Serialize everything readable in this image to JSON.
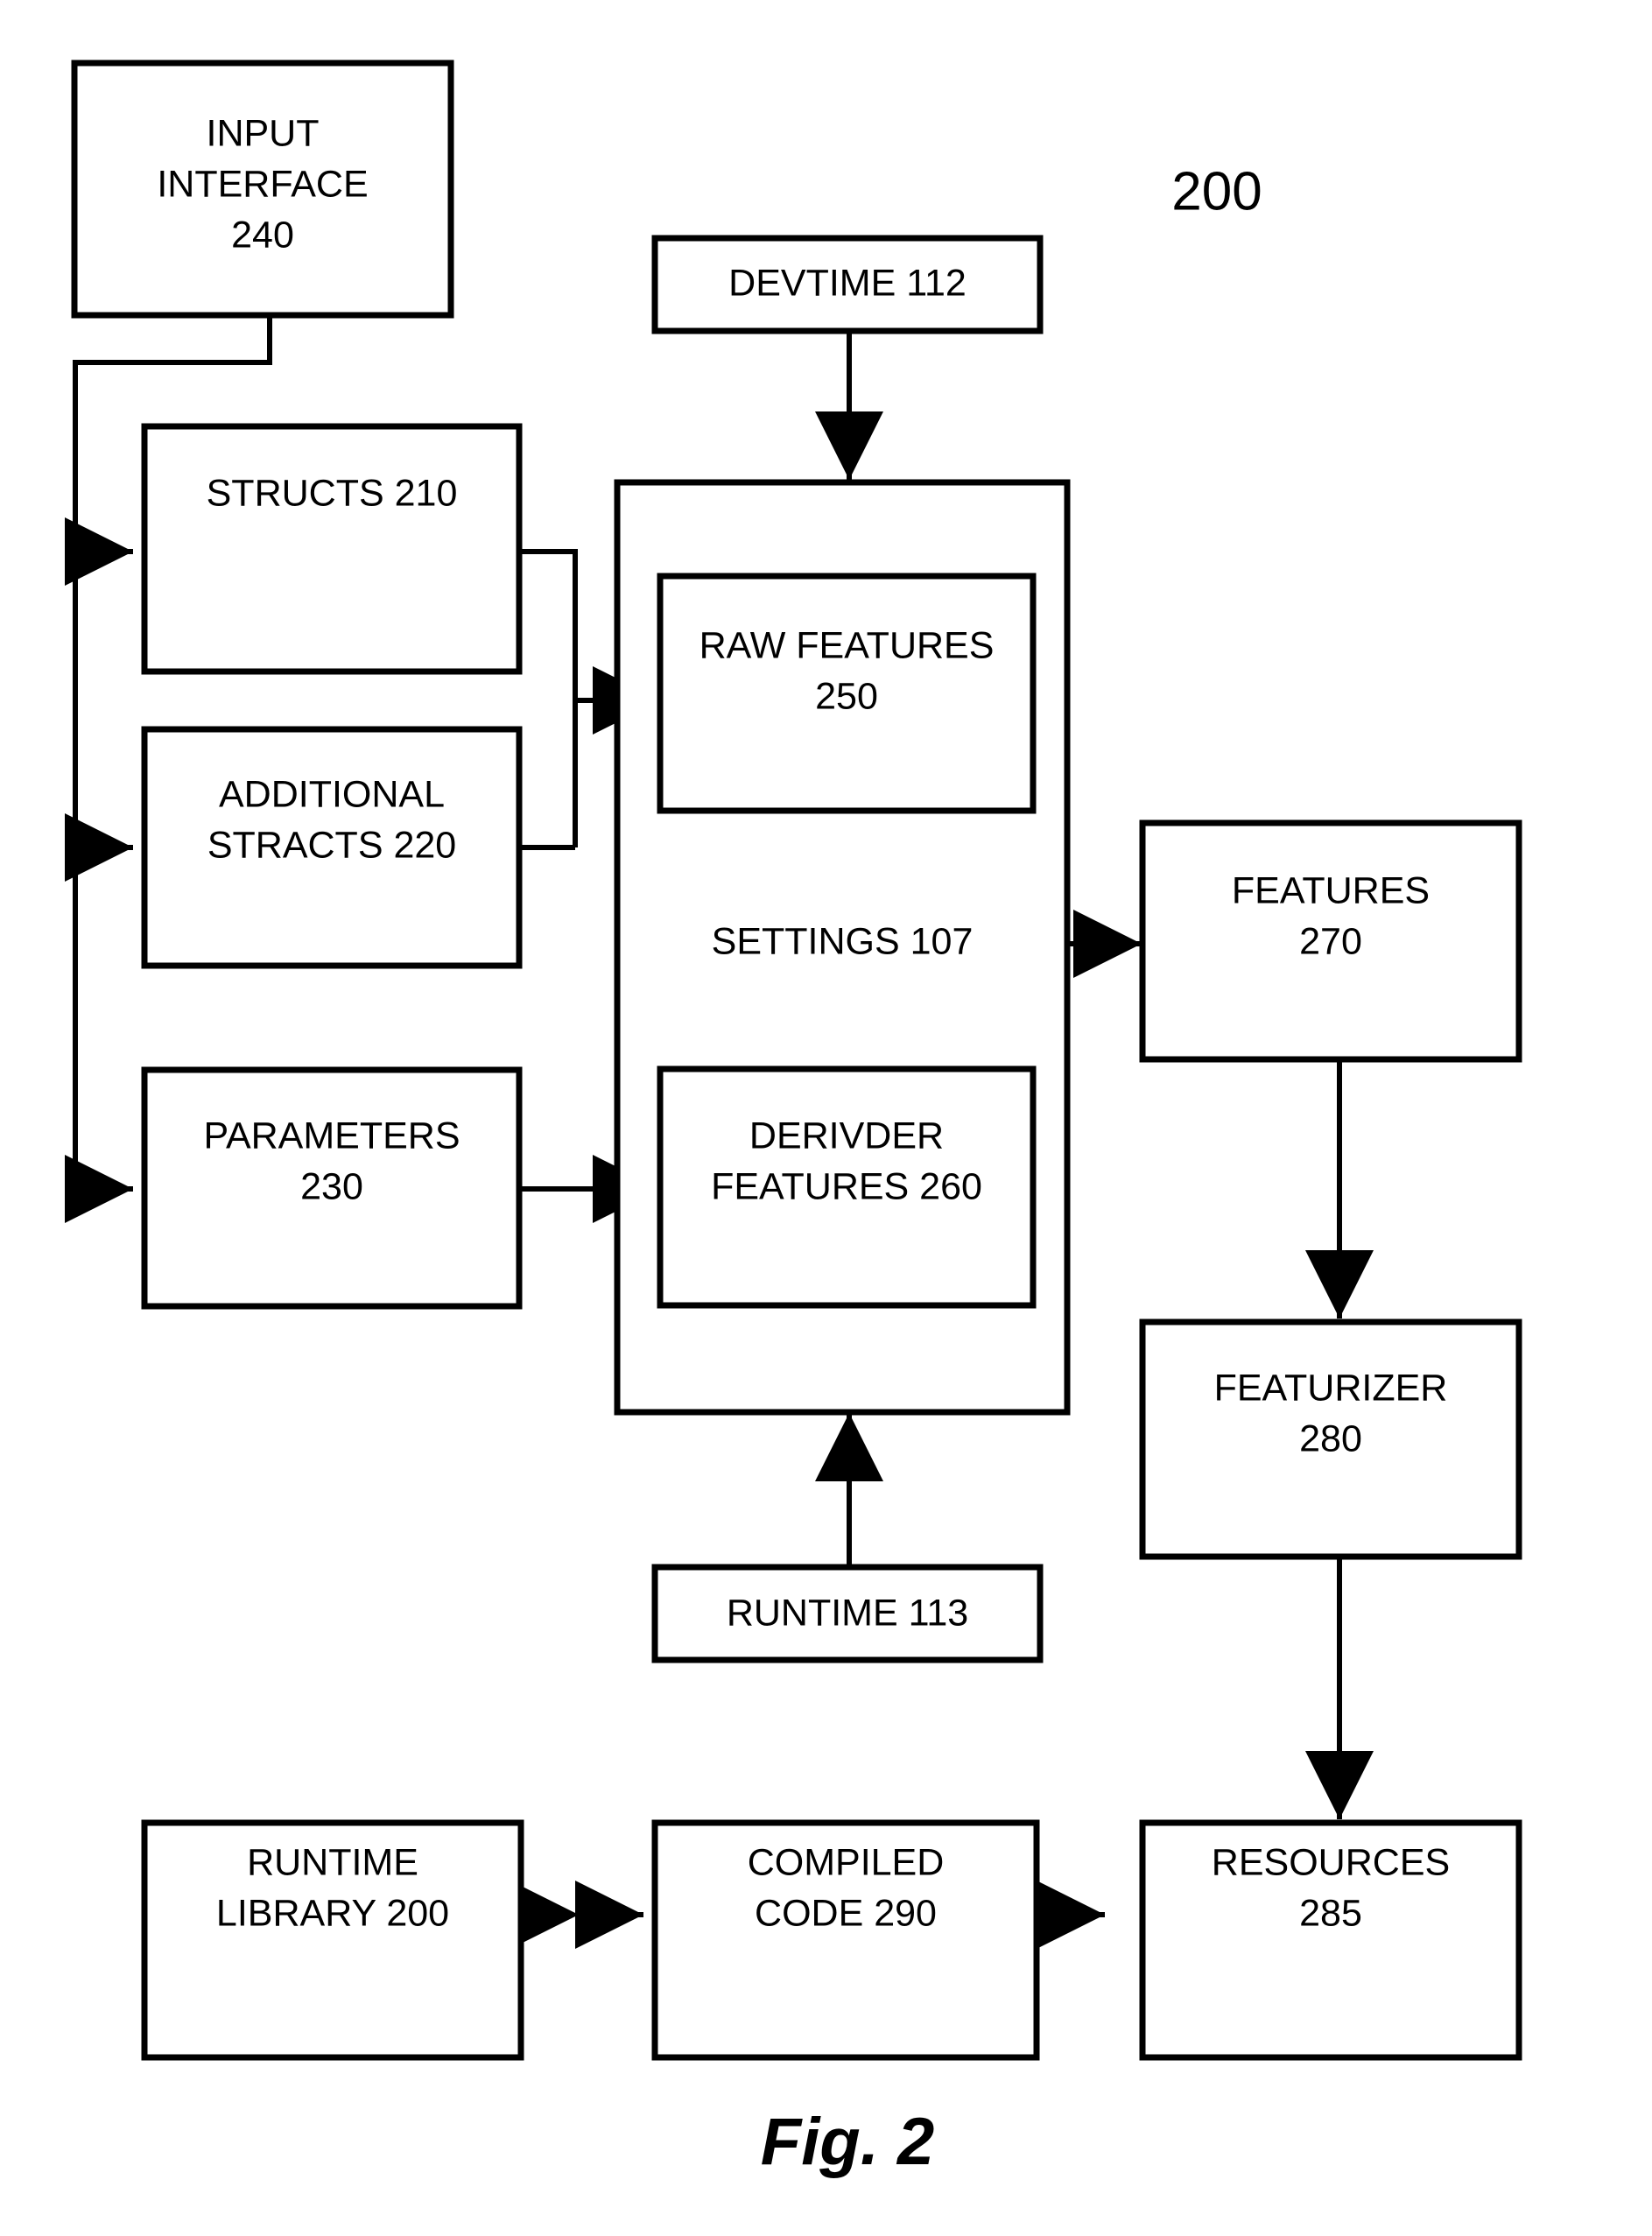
{
  "figure": {
    "caption": "Fig. 2",
    "reference_numeral": "200"
  },
  "nodes": {
    "input_interface": {
      "line1": "INPUT",
      "line2": "INTERFACE",
      "line3": "240"
    },
    "devtime": {
      "line1": "DEVTIME 112"
    },
    "structs": {
      "line1": "STRUCTS 210"
    },
    "additional_stracts": {
      "line1": "ADDITIONAL",
      "line2": "STRACTS 220"
    },
    "parameters": {
      "line1": "PARAMETERS",
      "line2": "230"
    },
    "settings": {
      "line1": "SETTINGS 107"
    },
    "raw_features": {
      "line1": "RAW FEATURES",
      "line2": "250"
    },
    "derivder_features": {
      "line1": "DERIVDER",
      "line2": "FEATURES 260"
    },
    "runtime": {
      "line1": "RUNTIME 113"
    },
    "features": {
      "line1": "FEATURES",
      "line2": "270"
    },
    "featurizer": {
      "line1": "FEATURIZER",
      "line2": "280"
    },
    "resources": {
      "line1": "RESOURCES",
      "line2": "285"
    },
    "compiled_code": {
      "line1": "COMPILED",
      "line2": "CODE 290"
    },
    "runtime_library": {
      "line1": "RUNTIME",
      "line2": "LIBRARY 200"
    }
  },
  "colors": {
    "stroke": "#000000",
    "fill": "#ffffff",
    "text": "#000000"
  }
}
